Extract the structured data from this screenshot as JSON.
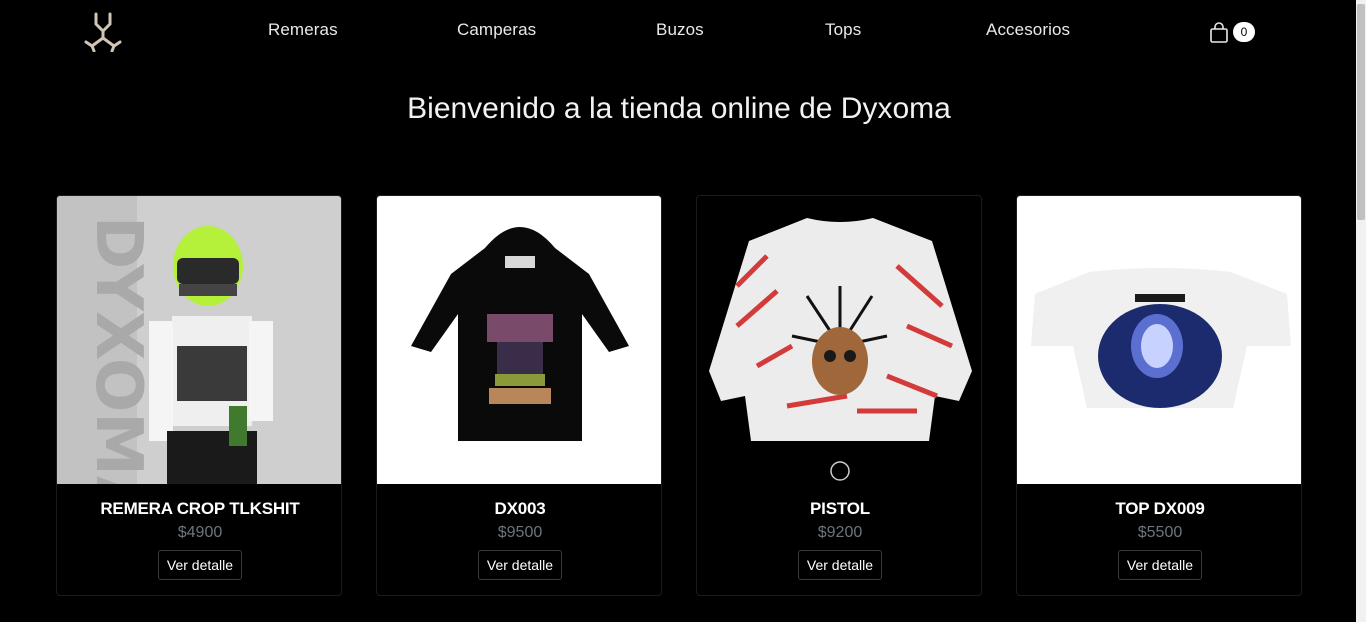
{
  "nav": {
    "logo_icon": "dyxoma-trident-logo-icon",
    "links": [
      "Remeras",
      "Camperas",
      "Buzos",
      "Tops",
      "Accesorios"
    ],
    "cart_icon": "shopping-bag-icon",
    "cart_count": "0"
  },
  "welcome": "Bienvenido a la tienda online de Dyxoma",
  "products": [
    {
      "title": "REMERA CROP TLKSHIT",
      "price": "$4900",
      "button": "Ver detalle",
      "image_icon": "model-crop-tee-photo"
    },
    {
      "title": "DX003",
      "price": "$9500",
      "button": "Ver detalle",
      "image_icon": "black-hoodie-photo"
    },
    {
      "title": "PISTOL",
      "price": "$9200",
      "button": "Ver detalle",
      "image_icon": "graffiti-sweater-photo"
    },
    {
      "title": "TOP DX009",
      "price": "$5500",
      "button": "Ver detalle",
      "image_icon": "white-crop-top-photo"
    }
  ],
  "colors": {
    "background": "#000000",
    "price": "#6c757d",
    "accent": "#b5f03a"
  }
}
